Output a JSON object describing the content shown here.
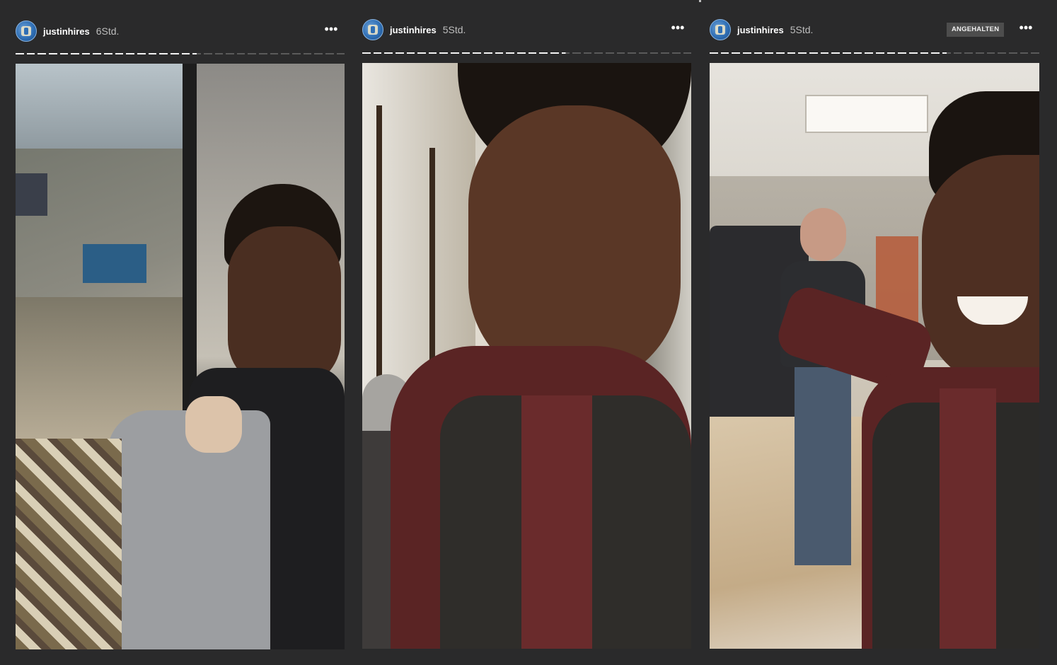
{
  "stories": [
    {
      "username": "justinhires",
      "time": "6Std.",
      "more_label": "•••",
      "progress": {
        "segments": 30,
        "done": 16,
        "partial": true
      },
      "badge": ""
    },
    {
      "username": "justinhires",
      "time": "5Std.",
      "more_label": "•••",
      "progress": {
        "segments": 30,
        "done": 18,
        "partial": true
      },
      "badge": ""
    },
    {
      "username": "justinhires",
      "time": "5Std.",
      "more_label": "•••",
      "progress": {
        "segments": 30,
        "done": 21,
        "partial": true
      },
      "badge": "ANGEHALTEN"
    }
  ],
  "colors": {
    "background": "#2a2a2b",
    "progress_done": "#f2f2f2",
    "progress_remaining": "#5a5a5a",
    "badge_bg": "#4d4d4d"
  }
}
